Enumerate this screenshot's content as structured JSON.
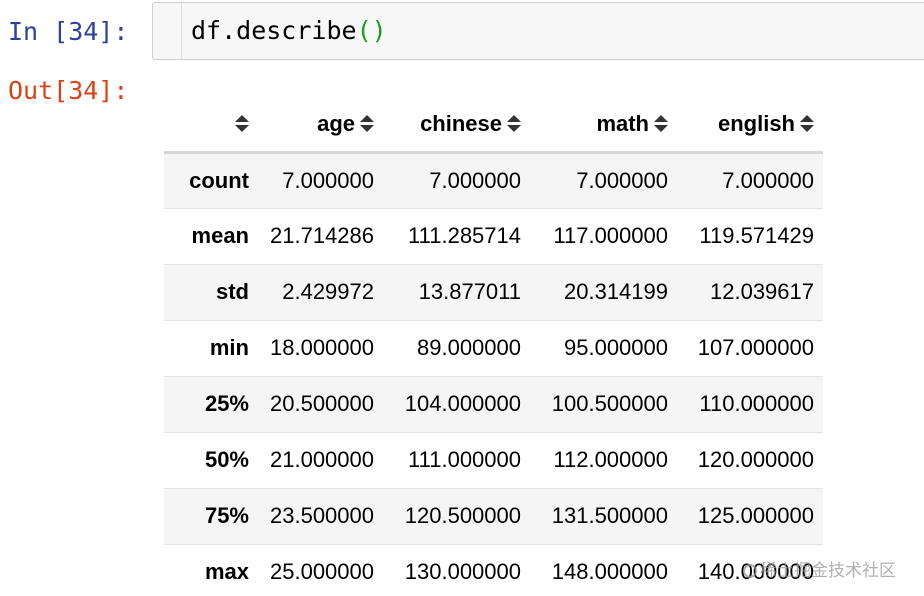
{
  "input_cell": {
    "prompt": "In [34]:",
    "code_func": "df.describe",
    "code_parens": "()"
  },
  "output_cell": {
    "prompt": "Out[34]:"
  },
  "table": {
    "index_header": "",
    "columns": [
      "age",
      "chinese",
      "math",
      "english"
    ],
    "rows": [
      {
        "label": "count",
        "values": [
          "7.000000",
          "7.000000",
          "7.000000",
          "7.000000"
        ]
      },
      {
        "label": "mean",
        "values": [
          "21.714286",
          "111.285714",
          "117.000000",
          "119.571429"
        ]
      },
      {
        "label": "std",
        "values": [
          "2.429972",
          "13.877011",
          "20.314199",
          "12.039617"
        ]
      },
      {
        "label": "min",
        "values": [
          "18.000000",
          "89.000000",
          "95.000000",
          "107.000000"
        ]
      },
      {
        "label": "25%",
        "values": [
          "20.500000",
          "104.000000",
          "100.500000",
          "110.000000"
        ]
      },
      {
        "label": "50%",
        "values": [
          "21.000000",
          "111.000000",
          "112.000000",
          "120.000000"
        ]
      },
      {
        "label": "75%",
        "values": [
          "23.500000",
          "120.500000",
          "131.500000",
          "125.000000"
        ]
      },
      {
        "label": "max",
        "values": [
          "25.000000",
          "130.000000",
          "148.000000",
          "140.000000"
        ]
      }
    ]
  },
  "watermark": {
    "text": "稀土掘金技术社区"
  },
  "colors": {
    "in_prompt": "#303F9F",
    "out_prompt": "#D84315",
    "paren": "#1a9e1a",
    "row_stripe": "#f5f5f5"
  }
}
